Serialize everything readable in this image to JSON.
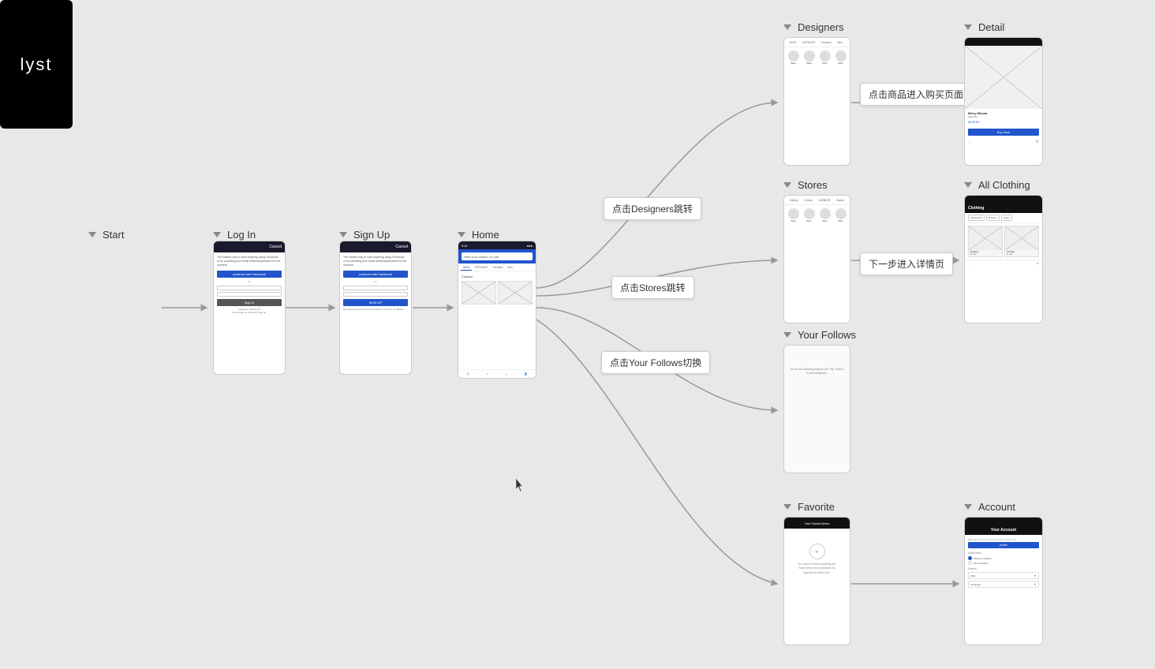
{
  "sections": {
    "start": {
      "label": "Start",
      "logo": "lyst"
    },
    "login": {
      "label": "Log In"
    },
    "signup": {
      "label": "Sign Up"
    },
    "home": {
      "label": "Home"
    },
    "designers": {
      "label": "Designers"
    },
    "stores": {
      "label": "Stores"
    },
    "your_follows": {
      "label": "Your Follows"
    },
    "favorite": {
      "label": "Favorite"
    },
    "detail": {
      "label": "Detail"
    },
    "all_clothing": {
      "label": "All Clothing"
    },
    "clothing_sub": {
      "label": "Clothing"
    },
    "account": {
      "label": "Account"
    }
  },
  "callouts": {
    "designers_nav": "点击Designers跳转",
    "stores_nav": "点击Stores跳转",
    "follows_nav": "点击Your Follows切换",
    "detail_desc": "点击商品进入购买页面",
    "next_step": "下一步进入详情页"
  },
  "home_screen": {
    "search_placeholder": "Start your search on Lyst",
    "tabs": [
      "WOS",
      "TOPSHOP",
      "Forward",
      "Neo..."
    ],
    "bottom_nav": [
      "Search",
      "Saved",
      "Discover",
      "Profile"
    ]
  },
  "account_screen": {
    "title": "Your Account",
    "email_label": "Edit links are used to confirm your email:",
    "profile_btn": "profile",
    "section_notification": "Notification",
    "options": [
      "Women's fashion",
      "Men's fashion"
    ],
    "section_search": "Search",
    "filters": [
      "Filter",
      "Language"
    ]
  }
}
